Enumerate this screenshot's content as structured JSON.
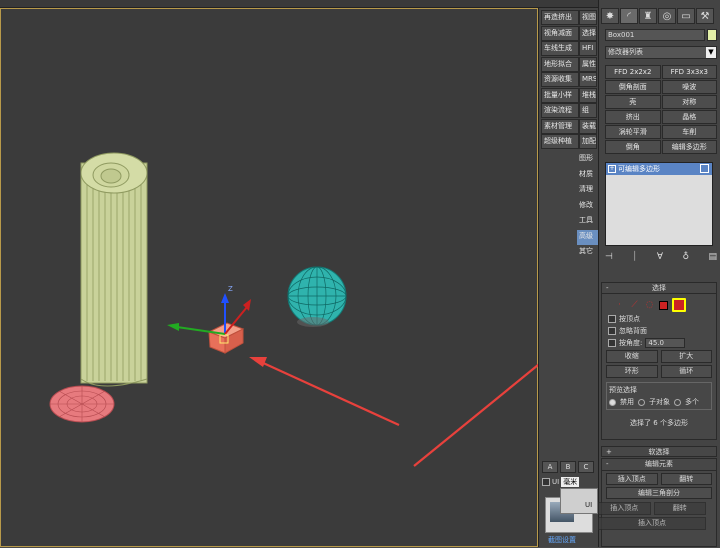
{
  "middle_panel": {
    "col_a": [
      "再造挤出",
      "视角减面",
      "车线生成",
      "地形拟合",
      "资源收集",
      "批量小样",
      "渲染流程",
      "素材管理",
      "超级种植"
    ],
    "col_b": [
      "视图",
      "选择",
      "HFI",
      "属性",
      "MRS",
      "堆栈",
      "组",
      "装载",
      "加配"
    ],
    "col_c": [
      "图形",
      "材质",
      "清理",
      "修改",
      "工具",
      "高级",
      "其它"
    ],
    "col_c_selected": "高级",
    "abc_tabs": [
      "A",
      "B",
      "C"
    ],
    "unit_checkbox": "UI",
    "unit_select": "毫米",
    "thumb_caption": "截图设置",
    "popup_text": "UI"
  },
  "command_panel": {
    "tabs": [
      "create-icon",
      "modify-icon",
      "hierarchy-icon",
      "motion-icon",
      "display-icon",
      "utilities-icon"
    ],
    "object_name": "Box001",
    "object_color": "#e3f0a8",
    "modifier_list": "修改器列表",
    "modifier_buttons": [
      "FFD 2x2x2",
      "FFD 3x3x3",
      "倒角剖面",
      "噪波",
      "壳",
      "对称",
      "挤出",
      "晶格",
      "涡轮平滑",
      "车削",
      "倒角",
      "编辑多边形"
    ],
    "stack_item": "可编辑多边形",
    "stack_tools": [
      "pin-icon",
      "show-end-icon",
      "make-unique-icon",
      "remove-modifier-icon",
      "configure-icon"
    ]
  },
  "selection_rollout": {
    "title": "选择",
    "sign": "-",
    "options": [
      "按顶点",
      "忽略背面",
      "按角度:"
    ],
    "angle_value": "45.0",
    "shrink": "收缩",
    "grow": "扩大",
    "ring": "环形",
    "loop": "循环",
    "preview_title": "预览选择",
    "preview_radios": [
      "禁用",
      "子对象",
      "多个"
    ],
    "status": "选择了 6 个多边形"
  },
  "soft_selection": {
    "sign": "+",
    "title": "软选择"
  },
  "edit_elements": {
    "sign": "-",
    "title": "编辑元素",
    "insert_vertex": "插入顶点",
    "flip": "翻转",
    "edit_tri": "编辑三角剖分",
    "ghost_insert_vertex": "插入顶点",
    "ghost_flip": "翻转",
    "ghost_insert_vertex2": "插入顶点"
  },
  "colors": {
    "viewport_bg": "#3b3b3b",
    "viewport_border": "#b89a4a",
    "selection_highlight": "#5a84c4",
    "arrow": "#e8413c"
  }
}
